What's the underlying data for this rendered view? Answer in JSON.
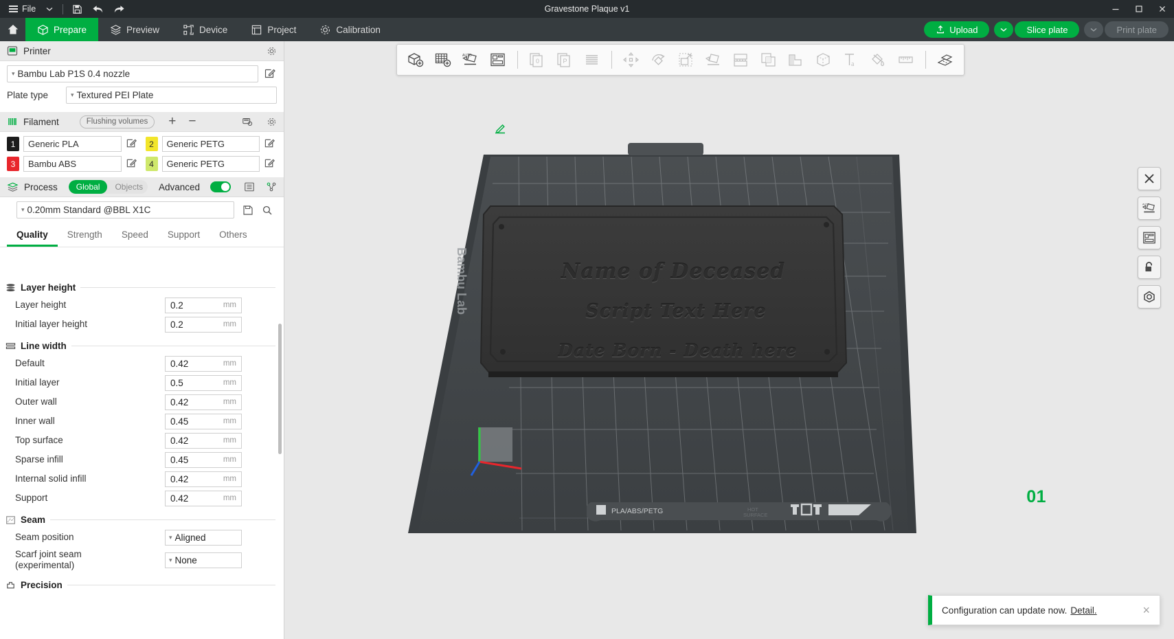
{
  "titlebar": {
    "menu_label": "File",
    "document_title": "Gravestone Plaque v1",
    "icons": {
      "save": "save-icon",
      "undo": "undo-icon",
      "redo": "redo-icon",
      "minimize": "minimize-icon",
      "maximize": "maximize-icon",
      "close": "close-icon"
    }
  },
  "topnav": {
    "home": "home-icon",
    "items": [
      {
        "label": "Prepare",
        "icon": "box-icon",
        "active": true
      },
      {
        "label": "Preview",
        "icon": "layers-icon",
        "active": false
      },
      {
        "label": "Device",
        "icon": "device-icon",
        "active": false
      },
      {
        "label": "Project",
        "icon": "project-icon",
        "active": false
      },
      {
        "label": "Calibration",
        "icon": "gear-icon",
        "active": false
      }
    ],
    "upload_label": "Upload",
    "slice_label": "Slice plate",
    "print_label": "Print plate"
  },
  "printer": {
    "section_title": "Printer",
    "preset": "Bambu Lab P1S 0.4 nozzle",
    "plate_type_label": "Plate type",
    "plate_type": "Textured PEI Plate"
  },
  "filament": {
    "section_title": "Filament",
    "flushing_label": "Flushing volumes",
    "slots": [
      {
        "num": "1",
        "name": "Generic PLA",
        "color": "#1b1b1b",
        "text_color": "#ffffff"
      },
      {
        "num": "2",
        "name": "Generic PETG",
        "color": "#f2e52a",
        "text_color": "#2a2a2a"
      },
      {
        "num": "3",
        "name": "Bambu ABS",
        "color": "#e8262c",
        "text_color": "#ffffff"
      },
      {
        "num": "4",
        "name": "Generic PETG",
        "color": "#cfe86b",
        "text_color": "#2a2a2a"
      }
    ]
  },
  "process": {
    "section_title": "Process",
    "scope_global": "Global",
    "scope_objects": "Objects",
    "advanced_label": "Advanced",
    "advanced_on": true,
    "preset": "0.20mm Standard @BBL X1C",
    "tabs": [
      {
        "label": "Quality",
        "active": true
      },
      {
        "label": "Strength",
        "active": false
      },
      {
        "label": "Speed",
        "active": false
      },
      {
        "label": "Support",
        "active": false
      },
      {
        "label": "Others",
        "active": false
      }
    ],
    "groups": [
      {
        "name": "Layer height",
        "icon": "layer-height-icon",
        "params": [
          {
            "label": "Layer height",
            "value": "0.2",
            "unit": "mm",
            "type": "number"
          },
          {
            "label": "Initial layer height",
            "value": "0.2",
            "unit": "mm",
            "type": "number"
          }
        ]
      },
      {
        "name": "Line width",
        "icon": "line-width-icon",
        "params": [
          {
            "label": "Default",
            "value": "0.42",
            "unit": "mm",
            "type": "number"
          },
          {
            "label": "Initial layer",
            "value": "0.5",
            "unit": "mm",
            "type": "number"
          },
          {
            "label": "Outer wall",
            "value": "0.42",
            "unit": "mm",
            "type": "number"
          },
          {
            "label": "Inner wall",
            "value": "0.45",
            "unit": "mm",
            "type": "number"
          },
          {
            "label": "Top surface",
            "value": "0.42",
            "unit": "mm",
            "type": "number"
          },
          {
            "label": "Sparse infill",
            "value": "0.45",
            "unit": "mm",
            "type": "number"
          },
          {
            "label": "Internal solid infill",
            "value": "0.42",
            "unit": "mm",
            "type": "number"
          },
          {
            "label": "Support",
            "value": "0.42",
            "unit": "mm",
            "type": "number"
          }
        ]
      },
      {
        "name": "Seam",
        "icon": "seam-icon",
        "params": [
          {
            "label": "Seam position",
            "value": "Aligned",
            "unit": "",
            "type": "select"
          },
          {
            "label": "Scarf joint seam\n(experimental)",
            "value": "None",
            "unit": "",
            "type": "select"
          }
        ]
      },
      {
        "name": "Precision",
        "icon": "precision-icon",
        "params": []
      }
    ]
  },
  "viewport": {
    "object_toolbar": [
      "add-object-icon",
      "add-plate-icon",
      "auto-arrange-icon",
      "layout-icon",
      "split-to-objects-icon",
      "split-to-parts-icon",
      "variable-layer-height-icon",
      "move-icon",
      "rotate-icon",
      "scale-icon",
      "lay-on-face-icon",
      "cut-icon",
      "mesh-boolean-icon",
      "support-painting-icon",
      "color-painting-icon",
      "text-icon",
      "fuzzy-skin-icon",
      "measure-icon",
      "assembly-icon"
    ],
    "right_tools": [
      "delete-icon",
      "auto-arrange-icon",
      "layout-icon",
      "lock-icon",
      "target-icon"
    ],
    "plate_number": "01",
    "edit_icon": "pencil-icon",
    "plate_brand": "Bambu Lab",
    "plate_material": "PLA/ABS/PETG",
    "plate_surface": "HOT SURFACE",
    "model_lines": [
      "Name of Deceased",
      "Script Text Here",
      "Date Born - Death here"
    ]
  },
  "toast": {
    "message": "Configuration can update now.",
    "link": "Detail.",
    "close": "close-icon"
  },
  "colors": {
    "accent_green": "#00ae42",
    "titlebar_bg": "#262b2e",
    "nav_bg": "#363c3f",
    "viewport_bg": "#e8e8e8",
    "plate_dark": "#3e4245"
  }
}
